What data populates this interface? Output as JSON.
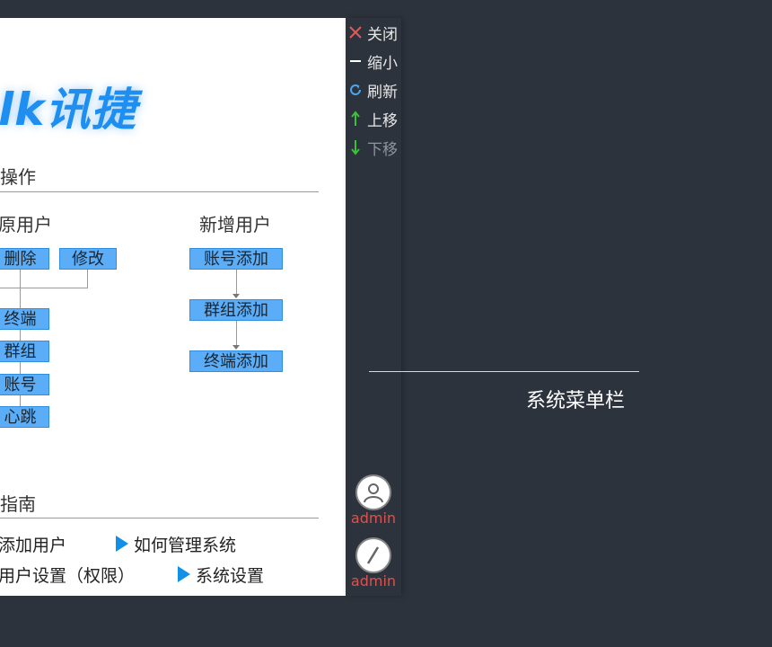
{
  "logo": {
    "text": "lk讯捷"
  },
  "operations": {
    "section_title": "操作",
    "col1_title": "原用户",
    "col2_title": "新增用户",
    "buttons_row": [
      "删除",
      "修改"
    ],
    "chain_left": [
      "终端",
      "群组",
      "账号",
      "心跳"
    ],
    "chain_right": [
      "账号添加",
      "群组添加",
      "终端添加"
    ]
  },
  "guide": {
    "section_title": "指南",
    "items": [
      "添加用户",
      "如何管理系统",
      "用户设置（权限）",
      "系统设置"
    ]
  },
  "sidebar": {
    "menu": [
      {
        "icon": "close-icon",
        "label": "关闭"
      },
      {
        "icon": "minimize-icon",
        "label": "缩小"
      },
      {
        "icon": "refresh-icon",
        "label": "刷新"
      },
      {
        "icon": "arrow-up-icon",
        "label": "上移"
      },
      {
        "icon": "arrow-down-icon",
        "label": "下移"
      }
    ],
    "users": [
      {
        "icon": "user-avatar-icon",
        "name": "admin"
      },
      {
        "icon": "pen-icon",
        "name": "admin"
      }
    ]
  },
  "annotation": {
    "label": "系统菜单栏"
  },
  "colors": {
    "background": "#2d333c",
    "button_fill": "#5aadf6",
    "accent_blue": "#1190e8",
    "close_red": "#e05a5a",
    "arrow_green": "#3ac13a",
    "admin_red": "#d9534f"
  }
}
